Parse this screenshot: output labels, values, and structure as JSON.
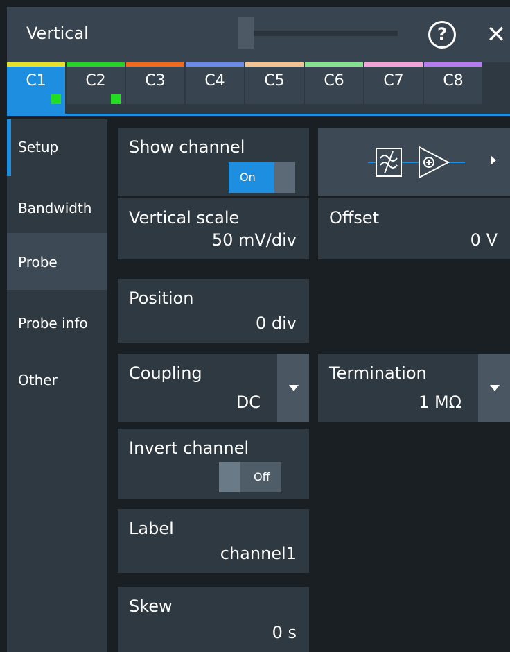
{
  "title": "Vertical",
  "channel_tabs": [
    {
      "label": "C1",
      "color": "#e7e02a",
      "active": true,
      "indicator": true
    },
    {
      "label": "C2",
      "color": "#27d12a",
      "active": false,
      "indicator": true
    },
    {
      "label": "C3",
      "color": "#f06a1e",
      "active": false,
      "indicator": false
    },
    {
      "label": "C4",
      "color": "#6a8ae8",
      "active": false,
      "indicator": false
    },
    {
      "label": "C5",
      "color": "#f2c290",
      "active": false,
      "indicator": false
    },
    {
      "label": "C6",
      "color": "#86e28e",
      "active": false,
      "indicator": false
    },
    {
      "label": "C7",
      "color": "#f3a2d7",
      "active": false,
      "indicator": false
    },
    {
      "label": "C8",
      "color": "#b57cf0",
      "active": false,
      "indicator": false
    }
  ],
  "sidebar": {
    "items": [
      {
        "label": "Setup"
      },
      {
        "label": "Bandwidth"
      },
      {
        "label": "Probe"
      },
      {
        "label": "Probe info"
      },
      {
        "label": "Other"
      }
    ]
  },
  "settings": {
    "show_channel": {
      "label": "Show channel",
      "state": "On"
    },
    "vertical_scale": {
      "label": "Vertical scale",
      "value": "50 mV/div"
    },
    "offset": {
      "label": "Offset",
      "value": "0 V"
    },
    "position": {
      "label": "Position",
      "value": "0 div"
    },
    "coupling": {
      "label": "Coupling",
      "value": "DC"
    },
    "termination": {
      "label": "Termination",
      "value": "1 MΩ"
    },
    "invert_channel": {
      "label": "Invert channel",
      "state": "Off"
    },
    "label": {
      "label": "Label",
      "value": "channel1"
    },
    "skew": {
      "label": "Skew",
      "value": "0 s"
    }
  },
  "icons": {
    "help": "?",
    "close": "✕"
  },
  "colors": {
    "accent": "#1e8fe0",
    "panel": "#2f3942",
    "background": "#1a1f24"
  }
}
